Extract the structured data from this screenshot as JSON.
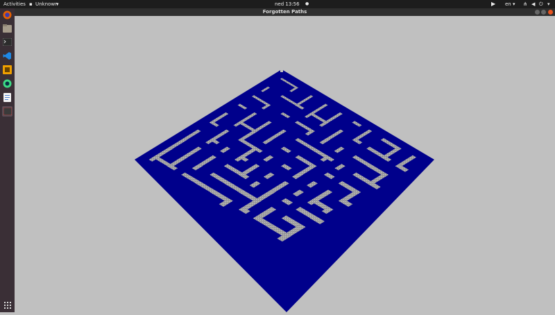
{
  "topbar": {
    "activities_label": "Activities",
    "app_menu_label": "Unknown",
    "clock": "ned 13:56",
    "language": "en"
  },
  "window": {
    "title": "Forgotten Paths"
  },
  "dock": {
    "items": [
      {
        "icon": "firefox-icon"
      },
      {
        "icon": "files-icon"
      },
      {
        "icon": "terminal-icon"
      },
      {
        "icon": "vscode-icon"
      },
      {
        "icon": "app-icon"
      },
      {
        "icon": "android-studio-icon"
      },
      {
        "icon": "text-editor-icon"
      },
      {
        "icon": "forgotten-paths-icon"
      }
    ],
    "grid_icon": "show-applications-icon"
  },
  "colors": {
    "maze_wall": "#00008b",
    "maze_floor": "#a6a6a6",
    "background": "#c0c0c0"
  }
}
